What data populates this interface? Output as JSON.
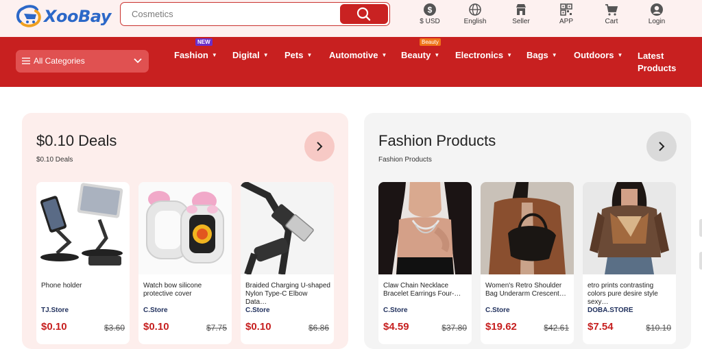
{
  "brand": {
    "name": "XooBay"
  },
  "search": {
    "value": "Cosmetics"
  },
  "toolbar": [
    {
      "label": "$ USD",
      "icon": "dollar-icon"
    },
    {
      "label": "English",
      "icon": "globe-icon"
    },
    {
      "label": "Seller",
      "icon": "store-icon"
    },
    {
      "label": "APP",
      "icon": "qr-code-icon"
    },
    {
      "label": "Cart",
      "icon": "cart-icon"
    },
    {
      "label": "Login",
      "icon": "user-icon"
    }
  ],
  "nav": {
    "all_categories": "All Categories",
    "items": [
      {
        "label": "Fashion",
        "badge": "NEW"
      },
      {
        "label": "Digital"
      },
      {
        "label": "Pets"
      },
      {
        "label": "Automotive"
      },
      {
        "label": "Beauty",
        "badge": "Beauty"
      },
      {
        "label": "Electronics"
      },
      {
        "label": "Bags"
      },
      {
        "label": "Outdoors"
      },
      {
        "label": "Latest Products",
        "line1": "Latest",
        "line2": "Products"
      }
    ]
  },
  "colors": {
    "brand_red": "#c82020",
    "price_red": "#c61f1f",
    "logo_blue": "#2c68c8"
  },
  "sections": [
    {
      "title": "$0.10 Deals",
      "subtitle": "$0.10 Deals",
      "products": [
        {
          "name": "Phone holder",
          "store": "TJ.Store",
          "price": "$0.10",
          "old_price": "$3.60"
        },
        {
          "name": "Watch bow silicone protective cover",
          "store": "C.Store",
          "price": "$0.10",
          "old_price": "$7.75"
        },
        {
          "name": "Braided Charging U-shaped Nylon Type-C Elbow Data…",
          "store": "C.Store",
          "price": "$0.10",
          "old_price": "$6.86"
        }
      ]
    },
    {
      "title": "Fashion Products",
      "subtitle": "Fashion Products",
      "products": [
        {
          "name": "Claw Chain Necklace Bracelet Earrings Four-…",
          "store": "C.Store",
          "price": "$4.59",
          "old_price": "$37.80"
        },
        {
          "name": "Women's Retro Shoulder Bag Underarm Crescent…",
          "store": "C.Store",
          "price": "$19.62",
          "old_price": "$42.61"
        },
        {
          "name": "etro prints contrasting colors pure desire style sexy…",
          "store": "DOBA.STORE",
          "price": "$7.54",
          "old_price": "$10.10"
        }
      ]
    }
  ]
}
